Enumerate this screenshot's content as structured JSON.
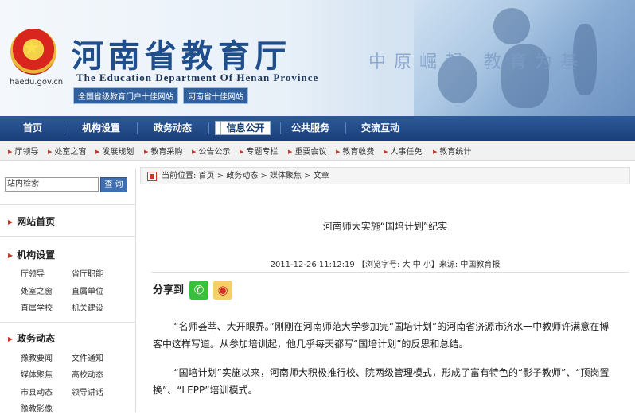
{
  "header": {
    "title_cn": "河南省教育厅",
    "title_en": "The Education Department Of Henan Province",
    "site_url": "haedu.gov.cn",
    "slogan": "中原崛起 教育为基",
    "badges": [
      "全国省级教育门户十佳网站",
      "河南省十佳网站"
    ]
  },
  "nav": {
    "items": [
      "首页",
      "机构设置",
      "政务动态",
      "信息公开",
      "公共服务",
      "交流互动"
    ],
    "active_index": 3,
    "dropdown_icon": "▾"
  },
  "subnav": {
    "items": [
      "厅领导",
      "处室之窗",
      "发展规划",
      "教育采购",
      "公告公示",
      "专题专栏",
      "重要会议",
      "教育收费",
      "人事任免",
      "教育统计"
    ]
  },
  "sidebar": {
    "search_value": "站内检索",
    "search_button": "查 询",
    "sections": [
      {
        "title": "网站首页",
        "links": []
      },
      {
        "title": "机构设置",
        "links": [
          "厅领导",
          "省厅职能",
          "处室之窗",
          "直属单位",
          "直属学校",
          "机关建设"
        ]
      },
      {
        "title": "政务动态",
        "links": [
          "豫教要闻",
          "文件通知",
          "媒体聚焦",
          "高校动态",
          "市县动态",
          "领导讲话",
          "豫教影像"
        ]
      }
    ]
  },
  "breadcrumb": {
    "label": "当前位置:",
    "path": "首页 > 政务动态 > 媒体聚焦 > 文章"
  },
  "article": {
    "title": "河南师大实施“国培计划”纪实",
    "meta": "2011-12-26 11:12:19 【浏览字号: 大 中 小】来源: 中国教育报",
    "share_label": "分享到",
    "share_wechat_glyph": "✆",
    "share_weibo_glyph": "◉",
    "paragraphs": [
      "“名师荟萃、大开眼界。”刚刚在河南师范大学参加完“国培计划”的河南省济源市济水一中教师许满意在博客中这样写道。从参加培训起，他几乎每天都写“国培计划”的反思和总结。",
      "“国培计划”实施以来，河南师大积极推行校、院两级管理模式，形成了富有特色的“影子教师”、“顶岗置换”、“LEPP”培训模式。"
    ]
  },
  "colors": {
    "nav_bg": "#1a3f78",
    "accent_red": "#c0392b",
    "title_blue": "#1f4e8c"
  }
}
